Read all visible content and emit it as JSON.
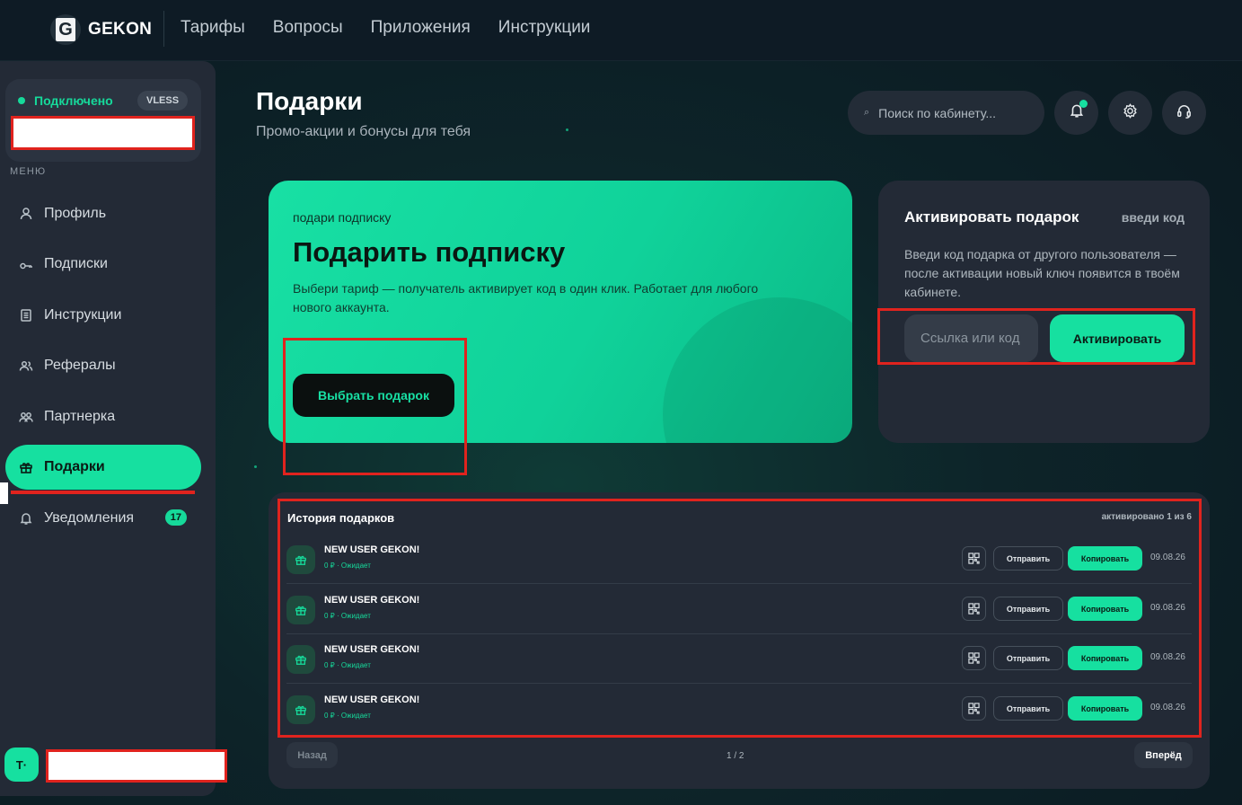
{
  "brand": {
    "logo_letter": "G",
    "name": "GEKON"
  },
  "topnav": [
    "Тарифы",
    "Вопросы",
    "Приложения",
    "Инструкции"
  ],
  "sidebar": {
    "status": "Подключено",
    "protocol": "VLESS",
    "menu_title": "МЕНЮ",
    "items": [
      {
        "label": "Профиль"
      },
      {
        "label": "Подписки"
      },
      {
        "label": "Инструкции"
      },
      {
        "label": "Рефералы"
      },
      {
        "label": "Партнерка"
      },
      {
        "label": "Подарки"
      },
      {
        "label": "Уведомления",
        "badge": "17"
      }
    ],
    "avatar": "T·"
  },
  "header": {
    "title": "Подарки",
    "subtitle": "Промо-акции и бонусы для тебя",
    "search_placeholder": "Поиск по кабинету..."
  },
  "gift": {
    "kicker": "подари подписку",
    "title": "Подарить подписку",
    "description": "Выбери тариф — получатель активирует код в один клик. Работает для любого нового аккаунта.",
    "button": "Выбрать подарок"
  },
  "activate": {
    "title": "Активировать подарок",
    "hint": "введи код",
    "description": "Введи код подарка от другого пользователя — после активации новый ключ появится в твоём кабинете.",
    "input_placeholder": "Ссылка или код",
    "button": "Активировать"
  },
  "history": {
    "title": "История подарков",
    "count": "активировано 1 из 6",
    "rows": [
      {
        "name": "NEW USER GEKON!",
        "meta": "0 ₽ · Ожидает",
        "send": "Отправить",
        "copy": "Копировать",
        "date": "09.08.26"
      },
      {
        "name": "NEW USER GEKON!",
        "meta": "0 ₽ · Ожидает",
        "send": "Отправить",
        "copy": "Копировать",
        "date": "09.08.26"
      },
      {
        "name": "NEW USER GEKON!",
        "meta": "0 ₽ · Ожидает",
        "send": "Отправить",
        "copy": "Копировать",
        "date": "09.08.26"
      },
      {
        "name": "NEW USER GEKON!",
        "meta": "0 ₽ · Ожидает",
        "send": "Отправить",
        "copy": "Копировать",
        "date": "09.08.26"
      }
    ],
    "prev": "Назад",
    "page": "1 / 2",
    "next": "Вперёд"
  },
  "colors": {
    "accent": "#16e0a0",
    "annotation": "#e0231e",
    "panel": "#232a36"
  }
}
